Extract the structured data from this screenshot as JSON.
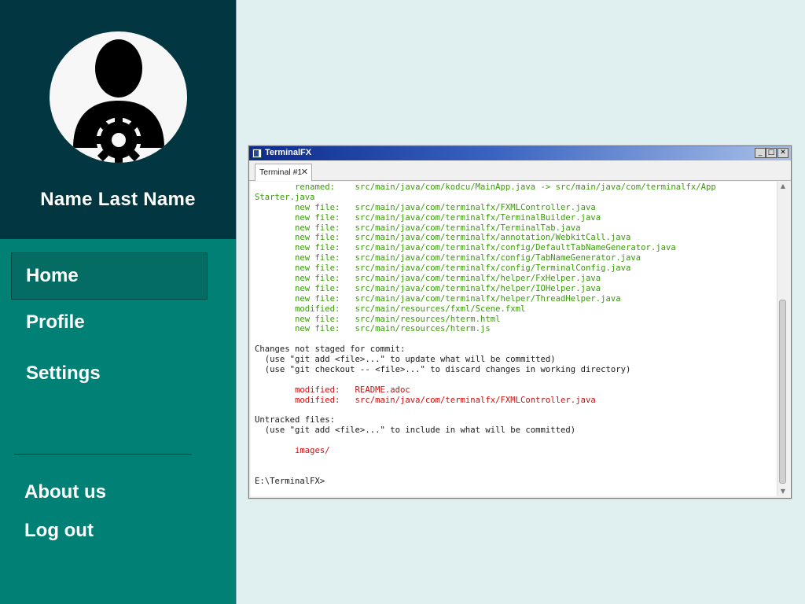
{
  "sidebar": {
    "user_name": "Name Last Name",
    "avatar_icon": "user-gear-icon",
    "nav": [
      {
        "label": "Home",
        "active": true
      },
      {
        "label": "Profile"
      },
      {
        "label": "Settings"
      }
    ],
    "footer_nav": [
      {
        "label": "About us"
      },
      {
        "label": "Log out"
      }
    ],
    "colors": {
      "header_bg": "#023640",
      "nav_bg": "#018076",
      "active_bg": "#046c63"
    }
  },
  "window": {
    "title": "TerminalFX",
    "buttons": {
      "minimize": "_",
      "maximize": "□",
      "close": "✕"
    },
    "tab": {
      "label": "Terminal #1",
      "close": "✕"
    },
    "lines": [
      "        renamed:    src/main/java/com/kodcu/MainApp.java -> src/main/java/com/terminalfx/App",
      "Starter.java",
      "        new file:   src/main/java/com/terminalfx/FXMLController.java",
      "        new file:   src/main/java/com/terminalfx/TerminalBuilder.java",
      "        new file:   src/main/java/com/terminalfx/TerminalTab.java",
      "        new file:   src/main/java/com/terminalfx/annotation/WebkitCall.java",
      "        new file:   src/main/java/com/terminalfx/config/DefaultTabNameGenerator.java",
      "        new file:   src/main/java/com/terminalfx/config/TabNameGenerator.java",
      "        new file:   src/main/java/com/terminalfx/config/TerminalConfig.java",
      "        new file:   src/main/java/com/terminalfx/helper/FxHelper.java",
      "        new file:   src/main/java/com/terminalfx/helper/IOHelper.java",
      "        new file:   src/main/java/com/terminalfx/helper/ThreadHelper.java",
      "        modified:   src/main/resources/fxml/Scene.fxml",
      "        new file:   src/main/resources/hterm.html",
      "        new file:   src/main/resources/hterm.js",
      "",
      "Changes not staged for commit:",
      "  (use \"git add <file>...\" to update what will be committed)",
      "  (use \"git checkout -- <file>...\" to discard changes in working directory)",
      "",
      "        modified:   README.adoc",
      "        modified:   src/main/java/com/terminalfx/FXMLController.java",
      "",
      "Untracked files:",
      "  (use \"git add <file>...\" to include in what will be committed)",
      "",
      "        images/",
      "",
      "",
      "E:\\TerminalFX>"
    ],
    "line_colors": [
      "g",
      "g",
      "g",
      "g",
      "g",
      "g",
      "g",
      "g",
      "g",
      "g",
      "g",
      "g",
      "g",
      "g",
      "g",
      "",
      "",
      "",
      "",
      "",
      "r",
      "r",
      "",
      "",
      "",
      "",
      "r",
      "",
      "",
      ""
    ],
    "colors": {
      "staged": "#3a9a0a",
      "unstaged": "#cc1010",
      "text": "#1a1a1a"
    }
  }
}
